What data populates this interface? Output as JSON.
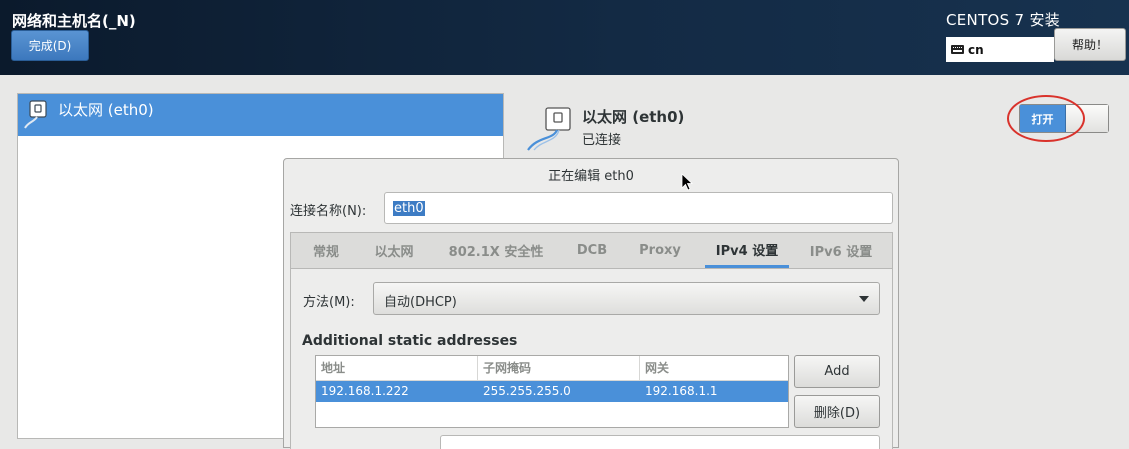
{
  "header": {
    "title": "网络和主机名(_N)",
    "done_label": "完成(D)",
    "install_title": "CENTOS 7 安装",
    "keyboard_layout": "cn",
    "help_label": "帮助！"
  },
  "connections": [
    {
      "label": "以太网 (eth0)",
      "selected": true
    }
  ],
  "device": {
    "name": "以太网 (eth0)",
    "status": "已连接",
    "switch_label": "打开",
    "switch_on": true
  },
  "dialog": {
    "title": "正在编辑 eth0",
    "connection_name_label": "连接名称(N):",
    "connection_name_value": "eth0",
    "tabs": [
      "常规",
      "以太网",
      "802.1X 安全性",
      "DCB",
      "Proxy",
      "IPv4 设置",
      "IPv6 设置"
    ],
    "active_tab": "IPv4 设置",
    "method_label": "方法(M):",
    "method_value": "自动(DHCP)",
    "addresses_heading": "Additional static addresses",
    "columns": [
      "地址",
      "子网掩码",
      "网关"
    ],
    "rows": [
      [
        "192.168.1.222",
        "255.255.255.0",
        "192.168.1.1"
      ]
    ],
    "add_label": "Add",
    "delete_label": "删除(D)"
  },
  "colors": {
    "accent": "#4a90d9",
    "header_bg": "#132a44",
    "annotation_circle": "#d9322b"
  }
}
